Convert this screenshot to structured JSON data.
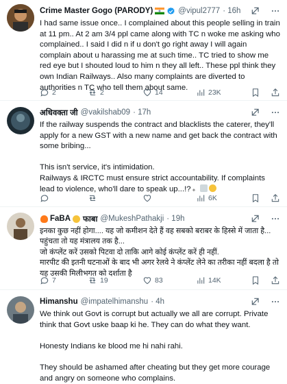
{
  "tweets": [
    {
      "name": "Crime Master Gogo (PARODY)",
      "handle": "@vipul2777",
      "time": "· 16h",
      "text": "I had same issue once.. I complained about this people selling in train at 11 pm.. At 2 am 3/4 ppl came along with TC n woke me asking who complained.. I said I did n if u don't go right away I will again complain about u harassing me at such time.. TC tried to show me red eye but I shouted loud to him n they all left.. These ppl think they own Indian Railways.. Also many complaints are diverted to authorities n TC who tell them about same.",
      "replies": "2",
      "retweets": "2",
      "likes": "14",
      "views": "23K"
    },
    {
      "name": "अधिवक्ता जी",
      "handle": "@vakilshab09",
      "time": "· 17h",
      "text": "If the railway suspends the contract and blacklists the caterer, they'll apply for a new GST with a new name and get back the contract with some bribing...\n\nThis isn't service, it's intimidation.\nRailways & IRCTC must ensure strict accountability. If complaints lead to violence, who'll dare to speak up...!?",
      "replies": "",
      "retweets": "",
      "likes": "",
      "views": "6K"
    },
    {
      "name": "FaBA",
      "name_suffix": "फाबा",
      "handle": "@MukeshPathakji",
      "time": "· 19h",
      "text": "इनका कुछ नहीं होगा.... यह जो कमीशन देते हैं वह सबको बराबर के हिस्से में जाता है... पहुंचता तो यह मंत्रालय तक है...\nजो कंप्लेंट करें उसको पिटवा दो ताकि आगे कोई कंप्लेंट करें ही नहीं.\nमारपीट की इतनी घटनाओं के बाद भी अगर रेलवे ने कंप्लेंट लेने का तरीका नहीं बदला है तो यह उसकी मिलीभगत को दर्शाता है",
      "replies": "7",
      "retweets": "19",
      "likes": "83",
      "views": "14K"
    },
    {
      "name": "Himanshu",
      "handle": "@impatelhimanshu",
      "time": "· 4h",
      "text": "We think out Govt is corrupt but actually we all are corrupt. Private think that Govt uske baap ki he. They can do what they want.\n\nHonesty Indians ke blood me hi nahi rahi.\n\nThey should be ashamed after cheating but they get more courage and angry on someone who complains.",
      "replies": "",
      "retweets": "",
      "likes": "",
      "views": ""
    }
  ],
  "colors": {
    "text": "#0f1419",
    "muted": "#536471",
    "verified": "#1d9bf0",
    "divider": "#eff3f4"
  },
  "icons": [
    "verified-badge-icon",
    "grok-icon",
    "more-icon",
    "reply-icon",
    "retweet-icon",
    "like-icon",
    "views-icon",
    "bookmark-icon",
    "share-icon"
  ]
}
